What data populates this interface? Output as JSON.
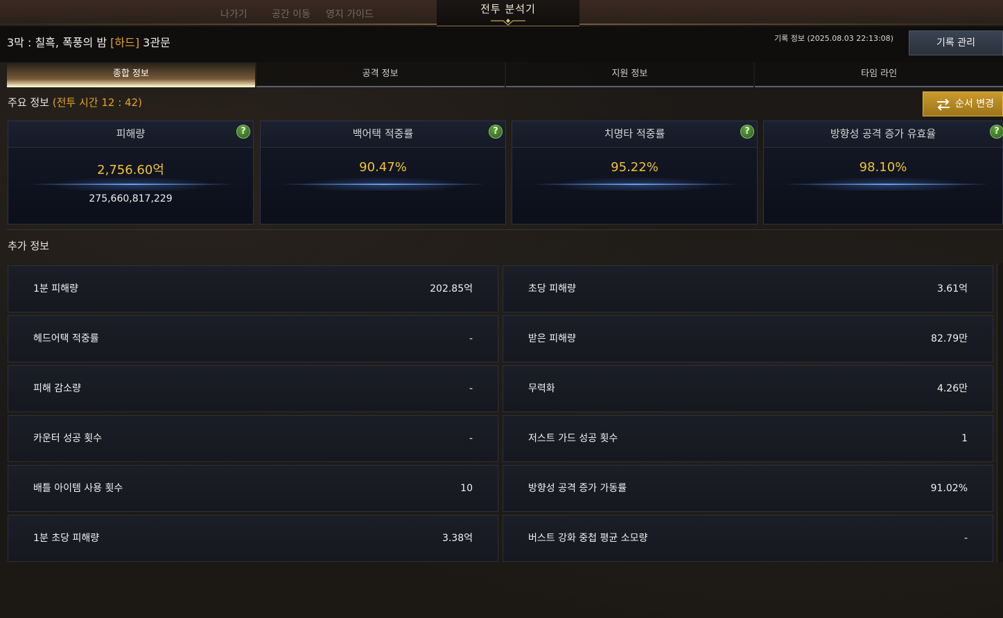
{
  "window": {
    "title": "전투 분석기"
  },
  "background_nav": [
    "나가기",
    "공간 이동",
    "영지 가이드"
  ],
  "header": {
    "stage_title_prefix": "3막 : 칠흑, 폭풍의 밤",
    "difficulty": "[하드]",
    "gate": "3관문",
    "record_info": "기록 정보 (2025.08.03 22:13:08)",
    "record_manage_label": "기록 관리"
  },
  "tabs": [
    {
      "label": "종합 정보",
      "active": true
    },
    {
      "label": "공격 정보",
      "active": false
    },
    {
      "label": "지원 정보",
      "active": false
    },
    {
      "label": "타임 라인",
      "active": false
    }
  ],
  "main_info": {
    "label": "주요 정보",
    "battle_time": "(전투 시간 12 : 42)",
    "order_change_label": "순서 변경",
    "cards": [
      {
        "title": "피해량",
        "value": "2,756.60억",
        "sub": "275,660,817,229"
      },
      {
        "title": "백어택 적중률",
        "value": "90.47%",
        "sub": ""
      },
      {
        "title": "치명타 적중률",
        "value": "95.22%",
        "sub": ""
      },
      {
        "title": "방향성 공격 증가 유효율",
        "value": "98.10%",
        "sub": ""
      }
    ],
    "help_glyph": "?"
  },
  "extra_info": {
    "label": "추가 정보",
    "rows": [
      {
        "left_label": "1분 피해량",
        "left_value": "202.85억",
        "right_label": "초당 피해량",
        "right_value": "3.61억"
      },
      {
        "left_label": "헤드어택 적중률",
        "left_value": "-",
        "right_label": "받은 피해량",
        "right_value": "82.79만"
      },
      {
        "left_label": "피해 감소량",
        "left_value": "-",
        "right_label": "무력화",
        "right_value": "4.26만"
      },
      {
        "left_label": "카운터 성공 횟수",
        "left_value": "-",
        "right_label": "저스트 가드 성공 횟수",
        "right_value": "1"
      },
      {
        "left_label": "배틀 아이템 사용 횟수",
        "left_value": "10",
        "right_label": "방향성 공격 증가 가동률",
        "right_value": "91.02%"
      },
      {
        "left_label": "1분 초당 피해량",
        "left_value": "3.38억",
        "right_label": "버스트 강화 중첩 평균 소모량",
        "right_value": "-"
      }
    ]
  },
  "colors": {
    "accent_gold": "#e6a42b",
    "value_yellow": "#f0c431",
    "order_button": "#c99a2c"
  },
  "icons": [
    "help-icon",
    "swap-icon",
    "title-ornament-icon"
  ]
}
